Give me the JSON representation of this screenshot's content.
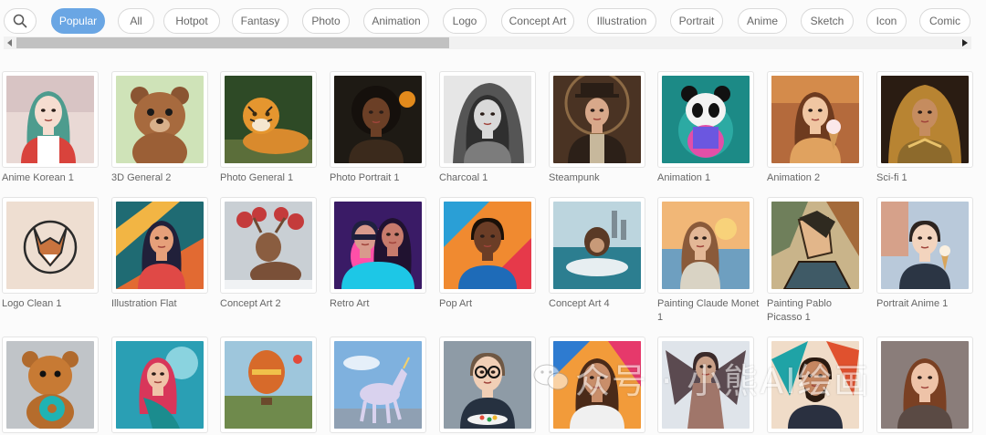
{
  "filters": {
    "search_icon": "search-icon",
    "chips": [
      {
        "label": "Popular",
        "active": true
      },
      {
        "label": "All",
        "active": false
      },
      {
        "label": "Hotpot",
        "active": false
      },
      {
        "label": "Fantasy",
        "active": false
      },
      {
        "label": "Photo",
        "active": false
      },
      {
        "label": "Animation",
        "active": false
      },
      {
        "label": "Logo",
        "active": false
      },
      {
        "label": "Concept Art",
        "active": false
      },
      {
        "label": "Illustration",
        "active": false
      },
      {
        "label": "Portrait",
        "active": false
      },
      {
        "label": "Anime",
        "active": false
      },
      {
        "label": "Sketch",
        "active": false
      },
      {
        "label": "Icon",
        "active": false
      },
      {
        "label": "Comic",
        "active": false
      }
    ]
  },
  "styles": {
    "row1": [
      {
        "label": "Anime Korean 1",
        "thumb": "anime-girl"
      },
      {
        "label": "3D General 2",
        "thumb": "teddy-bear"
      },
      {
        "label": "Photo General 1",
        "thumb": "tiger"
      },
      {
        "label": "Photo Portrait 1",
        "thumb": "portrait-woman"
      },
      {
        "label": "Charcoal 1",
        "thumb": "charcoal-woman"
      },
      {
        "label": "Steampunk",
        "thumb": "steampunk-man"
      },
      {
        "label": "Animation 1",
        "thumb": "panda"
      },
      {
        "label": "Animation 2",
        "thumb": "girl-icecream"
      },
      {
        "label": "Sci-fi 1",
        "thumb": "scifi-woman"
      }
    ],
    "row2": [
      {
        "label": "Logo Clean 1",
        "thumb": "fox-logo"
      },
      {
        "label": "Illustration Flat",
        "thumb": "flat-woman"
      },
      {
        "label": "Concept Art 2",
        "thumb": "reindeer"
      },
      {
        "label": "Retro Art",
        "thumb": "retro-couple"
      },
      {
        "label": "Pop Art",
        "thumb": "pop-man"
      },
      {
        "label": "Concept Art 4",
        "thumb": "monkey-boat"
      },
      {
        "label": "Painting Claude Monet 1",
        "thumb": "monet-woman"
      },
      {
        "label": "Painting Pablo Picasso 1",
        "thumb": "picasso-woman"
      },
      {
        "label": "Portrait Anime 1",
        "thumb": "anime-boy"
      }
    ],
    "row3": [
      {
        "label": "",
        "thumb": "bear-donut"
      },
      {
        "label": "",
        "thumb": "mermaid"
      },
      {
        "label": "",
        "thumb": "balloon"
      },
      {
        "label": "",
        "thumb": "unicorn"
      },
      {
        "label": "",
        "thumb": "baby-glasses"
      },
      {
        "label": "",
        "thumb": "smiling-woman"
      },
      {
        "label": "",
        "thumb": "winged-warrior"
      },
      {
        "label": "",
        "thumb": "bearded-man"
      },
      {
        "label": "",
        "thumb": "brunette-woman"
      }
    ]
  },
  "watermark": {
    "text": "众号 · 小熊AI绘画"
  },
  "colors": {
    "accent": "#6aa6e4"
  }
}
